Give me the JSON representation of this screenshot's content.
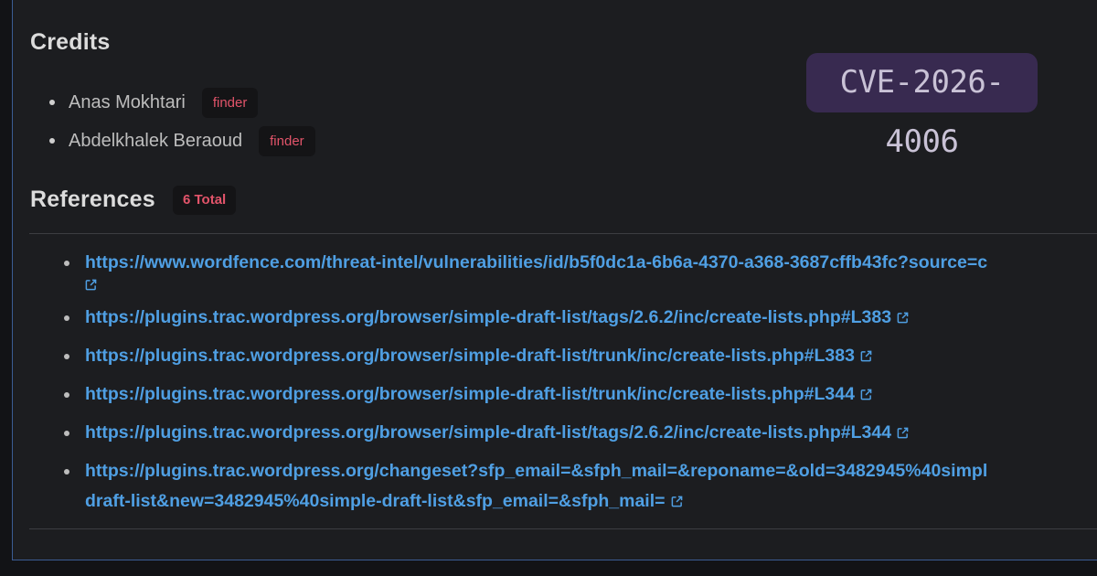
{
  "credits": {
    "title": "Credits",
    "items": [
      {
        "name": "Anas Mokhtari",
        "role": "finder"
      },
      {
        "name": "Abdelkhalek Beraoud",
        "role": "finder"
      }
    ]
  },
  "cve_badge": "CVE-2026-4006",
  "references": {
    "title": "References",
    "count_label": "6 Total",
    "items": [
      {
        "url_line1": "https://www.wordfence.com/threat-intel/vulnerabilities/id/b5f0dc1a-6b6a-4370-a368-3687cffb43fc?source=c",
        "url_line2": "",
        "icon": "external-link-icon"
      },
      {
        "url_line1": "https://plugins.trac.wordpress.org/browser/simple-draft-list/tags/2.6.2/inc/create-lists.php#L383",
        "icon": "external-link-icon"
      },
      {
        "url_line1": "https://plugins.trac.wordpress.org/browser/simple-draft-list/trunk/inc/create-lists.php#L383",
        "icon": "external-link-icon"
      },
      {
        "url_line1": "https://plugins.trac.wordpress.org/browser/simple-draft-list/trunk/inc/create-lists.php#L344",
        "icon": "external-link-icon"
      },
      {
        "url_line1": "https://plugins.trac.wordpress.org/browser/simple-draft-list/tags/2.6.2/inc/create-lists.php#L344",
        "icon": "external-link-icon"
      },
      {
        "url_line1": "https://plugins.trac.wordpress.org/changeset?sfp_email=&sfph_mail=&reponame=&old=3482945%40simpl",
        "url_line2": "draft-list&new=3482945%40simple-draft-list&sfp_email=&sfph_mail=",
        "icon": "external-link-icon"
      }
    ]
  },
  "colors": {
    "background": "#1c1d20",
    "link": "#4f9fe3",
    "badge_text": "#e2546a",
    "panel_border": "#3b5c94",
    "cve_badge_bg": "#382a50"
  }
}
